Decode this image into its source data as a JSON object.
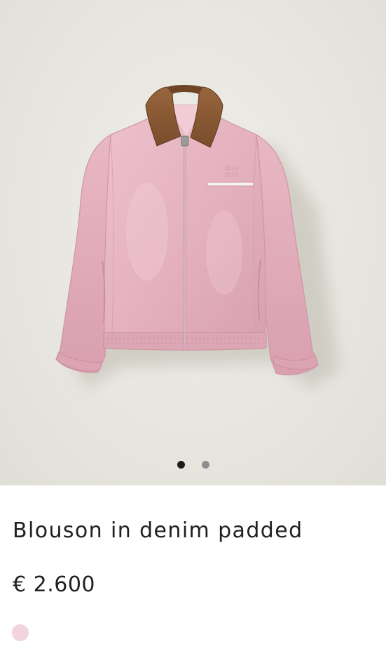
{
  "product": {
    "name": "Blouson in denim padded",
    "price": "€ 2.600",
    "image_name": "pink-denim-blouson-photo"
  },
  "gallery": {
    "image_count": 2,
    "active_index": 0
  },
  "colors": {
    "background": "#e7e6df",
    "jacket_pink": "#e8b9c6",
    "collar_brown": "#8a5a35",
    "dot_active": "#1c1c1c",
    "dot_inactive": "#8e8e8e"
  },
  "swatches": [
    {
      "color": "#f3d3dc",
      "selected": true
    }
  ]
}
